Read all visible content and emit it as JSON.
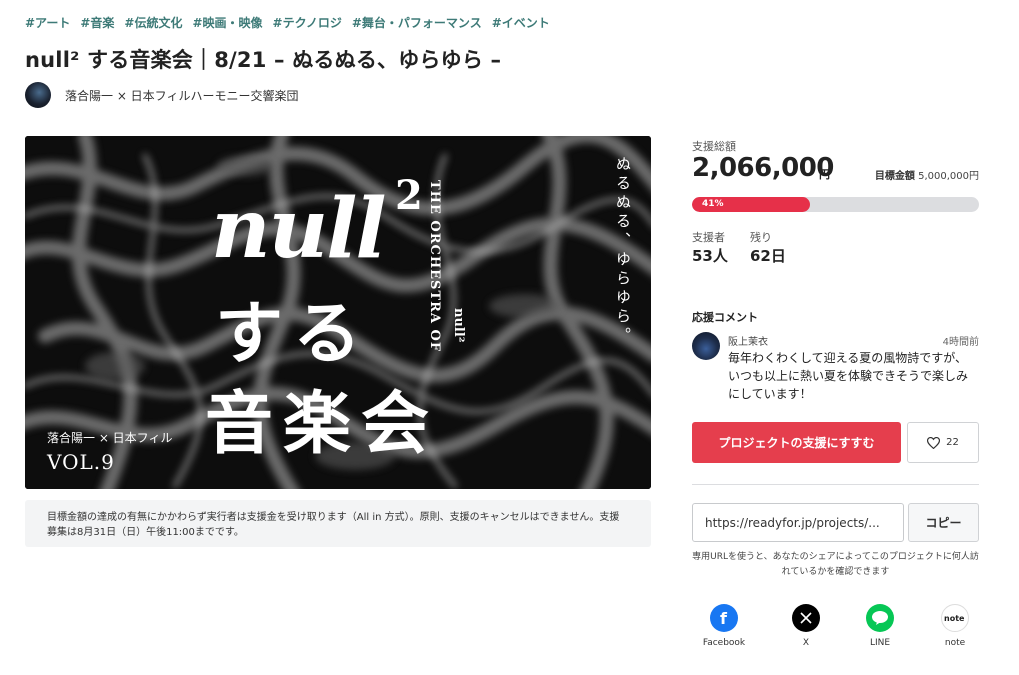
{
  "tags": [
    "#アート",
    "#音楽",
    "#伝統文化",
    "#映画・映像",
    "#テクノロジ",
    "#舞台・パフォーマンス",
    "#イベント"
  ],
  "title": "null² する音楽会｜8/21 – ぬるぬる、ゆらゆら –",
  "owner": {
    "name": "落合陽一 × 日本フィルハーモニー交響楽団"
  },
  "hero": {
    "null": "null",
    "superscript": "2",
    "suru": "する",
    "ongakukai": "音楽会",
    "orchestra": "THE ORCHESTRA OF",
    "orchestra_null": "null²",
    "nuru": "ぬるぬる、ゆらゆら。",
    "credit": "落合陽一 × 日本フィル",
    "vol": "VOL.9"
  },
  "notice": "目標金額の達成の有無にかかわらず実行者は支援金を受け取ります（All in 方式）。原則、支援のキャンセルはできません。支援募集は8月31日（日）午後11:00までです。",
  "funding": {
    "total_label": "支援総額",
    "amount": "2,066,000",
    "unit": "円",
    "goal_label": "目標金額",
    "goal_value": "5,000,000円",
    "progress_label": "41%",
    "progress_fraction": 0.41,
    "supporters_label": "支援者",
    "supporters_value": "53人",
    "remaining_label": "残り",
    "remaining_value": "62日"
  },
  "comments": {
    "heading": "応援コメント",
    "items": [
      {
        "name": "阪上茉衣",
        "time": "4時間前",
        "text": "毎年わくわくして迎える夏の風物詩ですが、いつも以上に熱い夏を体験できそうで楽しみにしています！"
      }
    ]
  },
  "actions": {
    "support_label": "プロジェクトの支援にすすむ",
    "like_count": "22"
  },
  "share": {
    "url": "https://readyfor.jp/projects/...",
    "copy_label": "コピー",
    "note": "専用URLを使うと、あなたのシェアによってこのプロジェクトに何人訪れているかを確認できます",
    "buttons": [
      {
        "label": "Facebook",
        "icon": "facebook-icon",
        "color": "#1877f2"
      },
      {
        "label": "X",
        "icon": "x-icon",
        "color": "#000000"
      },
      {
        "label": "LINE",
        "icon": "line-icon",
        "color": "#06c755"
      },
      {
        "label": "note",
        "icon": "note-icon",
        "color": "#ffffff"
      }
    ]
  },
  "colors": {
    "accent": "#e53e4d",
    "tag": "#3d7a77",
    "progress_track": "#dcdde0"
  }
}
